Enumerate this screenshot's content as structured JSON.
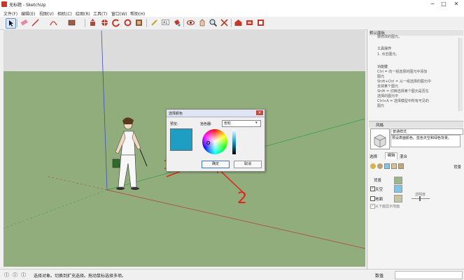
{
  "window": {
    "title": "无标题 - SketchUp",
    "controls": [
      "−",
      "□",
      "✕"
    ]
  },
  "menu": [
    "文件(F)",
    "编辑(E)",
    "视图(V)",
    "相机(C)",
    "绘图(R)",
    "工具(T)",
    "窗口(W)",
    "帮助(H)"
  ],
  "toolbar": {
    "icons": [
      "select-icon",
      "eraser-icon",
      "line-icon",
      "arc-icon",
      "rectangle-icon",
      "push-pull-icon",
      "move-icon",
      "rotate-icon",
      "scale-icon",
      "offset-icon",
      "tape-measure-icon",
      "text-icon",
      "paint-bucket-icon",
      "orbit-icon",
      "pan-icon",
      "zoom-icon",
      "zoom-extents-icon",
      "warehouse-icon",
      "extension-icon",
      "layout-icon"
    ]
  },
  "instructor": {
    "lines_top": [
      "要修改的图元。"
    ],
    "tool_ops_title": "工具操作",
    "tool_ops": [
      "1.   点击图元。"
    ],
    "modifier_title": "功能键",
    "modifier_lines": [
      "Ctrl = 向一组选择的图元中添加",
      "图元",
      "Shift+Ctrl = 从一组选择的图元中",
      "去掉某个图元",
      "Shift = 切换选择某个图元是否在",
      "选择的图元中",
      "Ctrl+A = 选择模型中所有可见的",
      "图元"
    ],
    "panel_title": "默认面板"
  },
  "styles_panel": {
    "header": "风格",
    "style_name": "普通样式",
    "style_desc": "预设表面颜色。蓝色天空和绿色背景。",
    "tabs": [
      "选择",
      "编辑",
      "混合"
    ],
    "section_label": "背景",
    "bg_label": "背景",
    "sky_label": "天空",
    "ground_label": "地面",
    "transparency_label": "透明度",
    "show_ground_from_below": "从下面显示地面",
    "colors": {
      "background": "#9cb58a",
      "sky": "#7ec5ea",
      "ground": "#c9c3a6"
    }
  },
  "dialog": {
    "title": "选择颜色",
    "preview_label": "预览:",
    "picker_label": "拾色器:",
    "picker_mode": "色轮",
    "ok": "确定",
    "cancel": "取消",
    "preview_color": "#1f9ec4"
  },
  "annotations": [
    "1",
    "2"
  ],
  "status": {
    "text": "选择对象。切换到扩充选择。拖动鼠标选择多项。",
    "measure_label": "数值"
  }
}
